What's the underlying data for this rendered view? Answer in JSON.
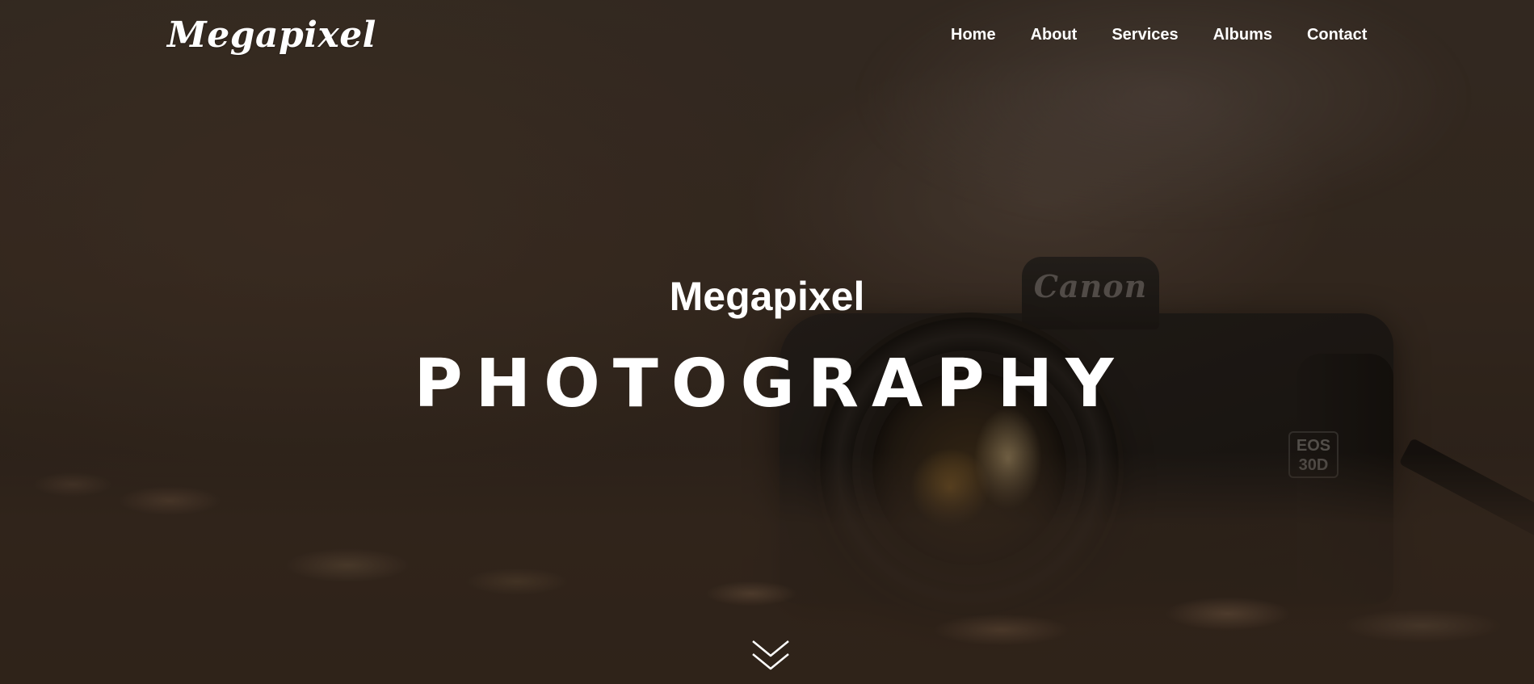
{
  "brand": {
    "logo_text": "Megapixel"
  },
  "nav": {
    "items": [
      {
        "label": "Home"
      },
      {
        "label": "About"
      },
      {
        "label": "Services"
      },
      {
        "label": "Albums"
      },
      {
        "label": "Contact"
      }
    ]
  },
  "hero": {
    "subtitle": "Megapixel",
    "title": "PHOTOGRAPHY",
    "scroll_icon": "double-chevron-down-icon"
  },
  "background_photo": {
    "camera_brand": "Canon",
    "camera_model": "EOS 30D"
  },
  "colors": {
    "text": "#ffffff",
    "overlay": "#2a211b"
  }
}
